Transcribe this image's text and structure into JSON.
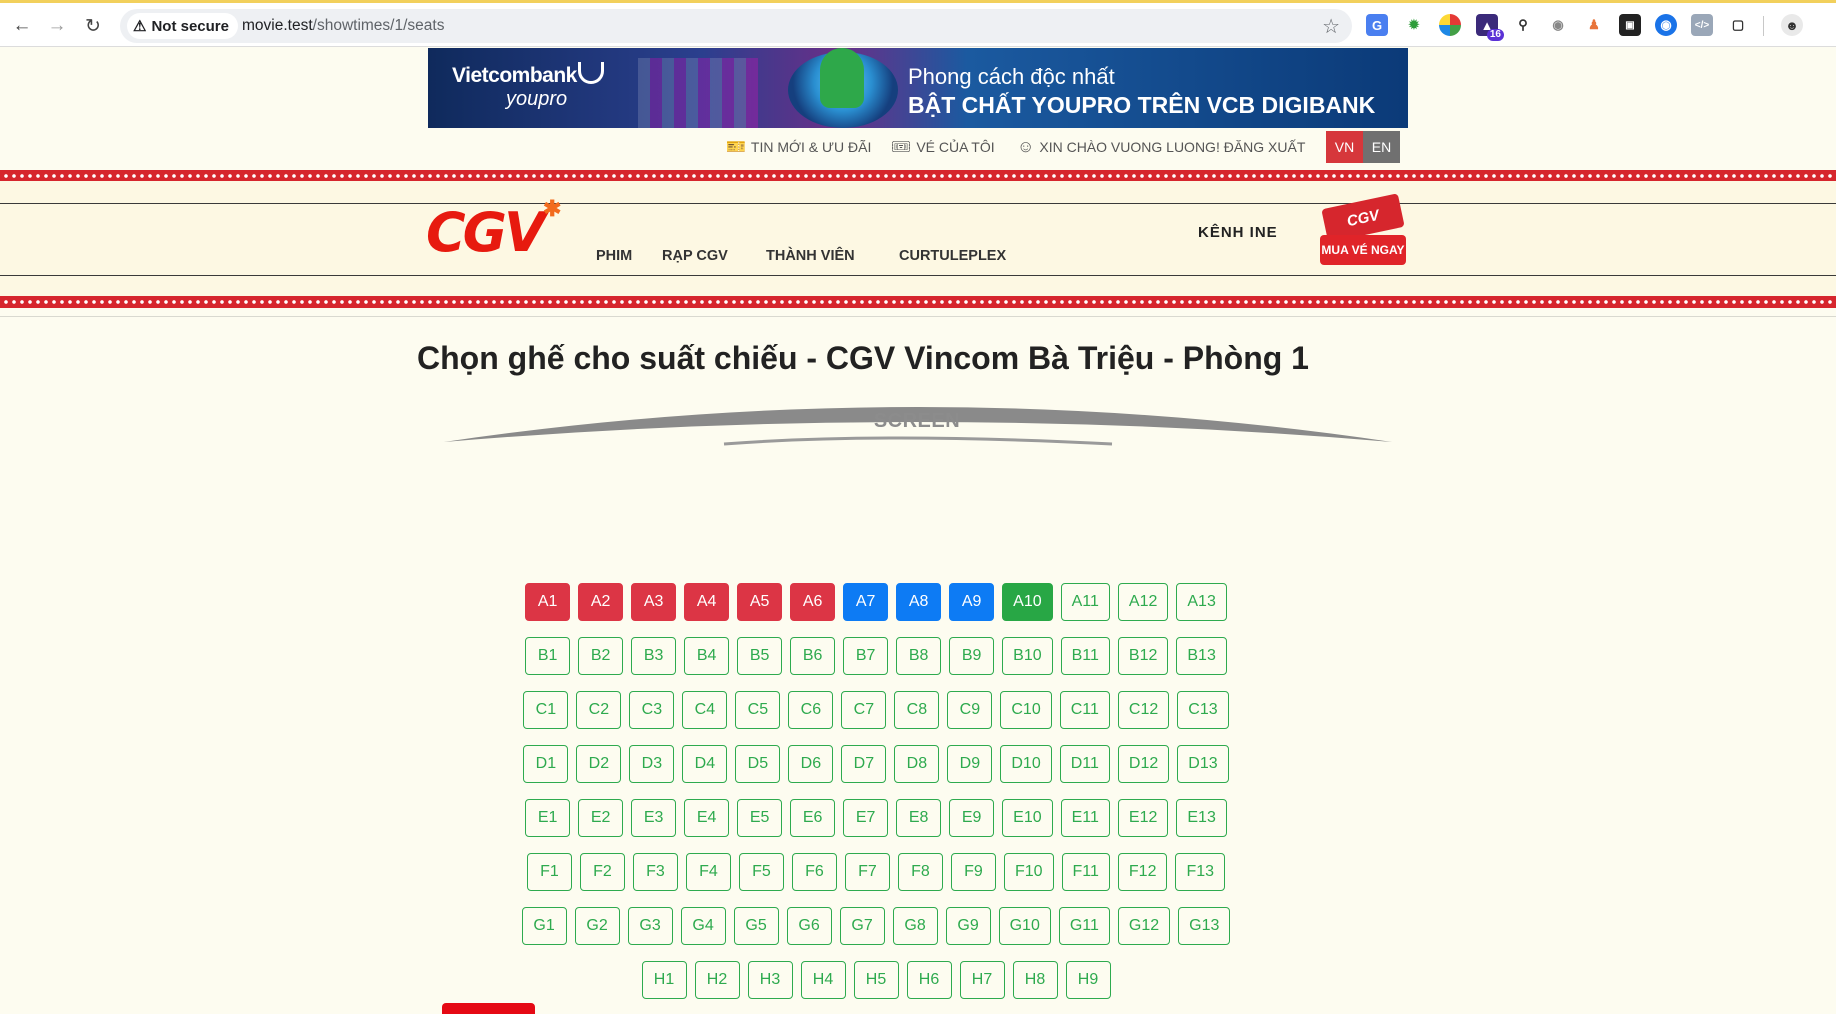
{
  "browser": {
    "security_label": "Not secure",
    "url_host": "movie.test",
    "url_path": "/showtimes/1/seats",
    "extension_badge": "16"
  },
  "banner": {
    "brand": "Vietcombank",
    "sub": "youpro",
    "line1": "Phong cách độc nhất",
    "line2": "BẬT CHẤT YOUPRO TRÊN VCB DIGIBANK"
  },
  "top_links": {
    "news": "TIN MỚI & ƯU ĐÃI",
    "my_tickets": "VÉ CỦA TÔI",
    "greeting": "XIN CHÀO VUONG LUONG! ĐĂNG XUẤT",
    "lang_vn": "VN",
    "lang_en": "EN"
  },
  "header": {
    "logo": "CGV",
    "menu": [
      "PHIM",
      "RẠP CGV",
      "THÀNH VIÊN",
      "CURTULEPLEX"
    ],
    "kenh_cine": "KÊNH  INE",
    "buy_top": "CGV",
    "buy_bottom": "MUA VÉ NGAY"
  },
  "main": {
    "title": "Chọn ghế cho suất chiếu - CGV Vincom Bà Triệu - Phòng 1",
    "screen_label": "SCREEN"
  },
  "colors": {
    "booked": "#dc3545",
    "held": "#0d7bf4",
    "selected": "#28a745",
    "available": "#2eaa4e",
    "brand_red": "#e71a0f"
  },
  "seat_rows": [
    {
      "row": "A",
      "seats": [
        {
          "label": "A1",
          "status": "booked"
        },
        {
          "label": "A2",
          "status": "booked"
        },
        {
          "label": "A3",
          "status": "booked"
        },
        {
          "label": "A4",
          "status": "booked"
        },
        {
          "label": "A5",
          "status": "booked"
        },
        {
          "label": "A6",
          "status": "booked"
        },
        {
          "label": "A7",
          "status": "held"
        },
        {
          "label": "A8",
          "status": "held"
        },
        {
          "label": "A9",
          "status": "held"
        },
        {
          "label": "A10",
          "status": "selected"
        },
        {
          "label": "A11",
          "status": "available"
        },
        {
          "label": "A12",
          "status": "available"
        },
        {
          "label": "A13",
          "status": "available"
        }
      ]
    },
    {
      "row": "B",
      "seats": [
        {
          "label": "B1",
          "status": "available"
        },
        {
          "label": "B2",
          "status": "available"
        },
        {
          "label": "B3",
          "status": "available"
        },
        {
          "label": "B4",
          "status": "available"
        },
        {
          "label": "B5",
          "status": "available"
        },
        {
          "label": "B6",
          "status": "available"
        },
        {
          "label": "B7",
          "status": "available"
        },
        {
          "label": "B8",
          "status": "available"
        },
        {
          "label": "B9",
          "status": "available"
        },
        {
          "label": "B10",
          "status": "available"
        },
        {
          "label": "B11",
          "status": "available"
        },
        {
          "label": "B12",
          "status": "available"
        },
        {
          "label": "B13",
          "status": "available"
        }
      ]
    },
    {
      "row": "C",
      "seats": [
        {
          "label": "C1",
          "status": "available"
        },
        {
          "label": "C2",
          "status": "available"
        },
        {
          "label": "C3",
          "status": "available"
        },
        {
          "label": "C4",
          "status": "available"
        },
        {
          "label": "C5",
          "status": "available"
        },
        {
          "label": "C6",
          "status": "available"
        },
        {
          "label": "C7",
          "status": "available"
        },
        {
          "label": "C8",
          "status": "available"
        },
        {
          "label": "C9",
          "status": "available"
        },
        {
          "label": "C10",
          "status": "available"
        },
        {
          "label": "C11",
          "status": "available"
        },
        {
          "label": "C12",
          "status": "available"
        },
        {
          "label": "C13",
          "status": "available"
        }
      ]
    },
    {
      "row": "D",
      "seats": [
        {
          "label": "D1",
          "status": "available"
        },
        {
          "label": "D2",
          "status": "available"
        },
        {
          "label": "D3",
          "status": "available"
        },
        {
          "label": "D4",
          "status": "available"
        },
        {
          "label": "D5",
          "status": "available"
        },
        {
          "label": "D6",
          "status": "available"
        },
        {
          "label": "D7",
          "status": "available"
        },
        {
          "label": "D8",
          "status": "available"
        },
        {
          "label": "D9",
          "status": "available"
        },
        {
          "label": "D10",
          "status": "available"
        },
        {
          "label": "D11",
          "status": "available"
        },
        {
          "label": "D12",
          "status": "available"
        },
        {
          "label": "D13",
          "status": "available"
        }
      ]
    },
    {
      "row": "E",
      "seats": [
        {
          "label": "E1",
          "status": "available"
        },
        {
          "label": "E2",
          "status": "available"
        },
        {
          "label": "E3",
          "status": "available"
        },
        {
          "label": "E4",
          "status": "available"
        },
        {
          "label": "E5",
          "status": "available"
        },
        {
          "label": "E6",
          "status": "available"
        },
        {
          "label": "E7",
          "status": "available"
        },
        {
          "label": "E8",
          "status": "available"
        },
        {
          "label": "E9",
          "status": "available"
        },
        {
          "label": "E10",
          "status": "available"
        },
        {
          "label": "E11",
          "status": "available"
        },
        {
          "label": "E12",
          "status": "available"
        },
        {
          "label": "E13",
          "status": "available"
        }
      ]
    },
    {
      "row": "F",
      "seats": [
        {
          "label": "F1",
          "status": "available"
        },
        {
          "label": "F2",
          "status": "available"
        },
        {
          "label": "F3",
          "status": "available"
        },
        {
          "label": "F4",
          "status": "available"
        },
        {
          "label": "F5",
          "status": "available"
        },
        {
          "label": "F6",
          "status": "available"
        },
        {
          "label": "F7",
          "status": "available"
        },
        {
          "label": "F8",
          "status": "available"
        },
        {
          "label": "F9",
          "status": "available"
        },
        {
          "label": "F10",
          "status": "available"
        },
        {
          "label": "F11",
          "status": "available"
        },
        {
          "label": "F12",
          "status": "available"
        },
        {
          "label": "F13",
          "status": "available"
        }
      ]
    },
    {
      "row": "G",
      "seats": [
        {
          "label": "G1",
          "status": "available"
        },
        {
          "label": "G2",
          "status": "available"
        },
        {
          "label": "G3",
          "status": "available"
        },
        {
          "label": "G4",
          "status": "available"
        },
        {
          "label": "G5",
          "status": "available"
        },
        {
          "label": "G6",
          "status": "available"
        },
        {
          "label": "G7",
          "status": "available"
        },
        {
          "label": "G8",
          "status": "available"
        },
        {
          "label": "G9",
          "status": "available"
        },
        {
          "label": "G10",
          "status": "available"
        },
        {
          "label": "G11",
          "status": "available"
        },
        {
          "label": "G12",
          "status": "available"
        },
        {
          "label": "G13",
          "status": "available"
        }
      ]
    },
    {
      "row": "H",
      "seats": [
        {
          "label": "H1",
          "status": "available"
        },
        {
          "label": "H2",
          "status": "available"
        },
        {
          "label": "H3",
          "status": "available"
        },
        {
          "label": "H4",
          "status": "available"
        },
        {
          "label": "H5",
          "status": "available"
        },
        {
          "label": "H6",
          "status": "available"
        },
        {
          "label": "H7",
          "status": "available"
        },
        {
          "label": "H8",
          "status": "available"
        },
        {
          "label": "H9",
          "status": "available"
        }
      ]
    }
  ]
}
